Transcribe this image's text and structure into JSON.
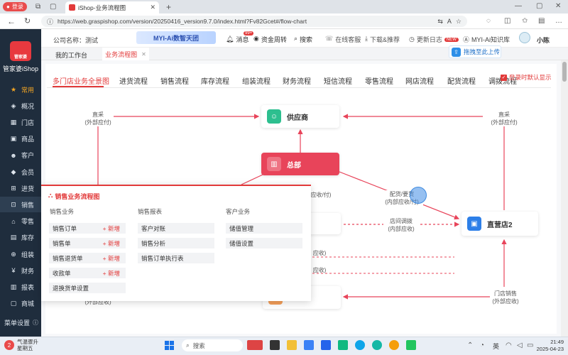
{
  "browser": {
    "profile_label": "登录",
    "tab_title": "iShop-业务流程图",
    "url": "https://web.graspishop.com/version/20250416_version9.7.0/index.html?Fv82Gcet#/flow-chart"
  },
  "header": {
    "company_label": "公司名称：测试",
    "banner": "MYI-Ai数智天团",
    "message_label": "消息",
    "message_badge": "99+",
    "funds_label": "资金周转",
    "search_label": "搜索",
    "service_label": "在线客服",
    "download_label": "下载&推荐",
    "update_label": "更新日志",
    "new_badge": "NEW",
    "ai_label": "MYI-Ai知识库",
    "user_name": "小陈",
    "drag_hint": "拖拽至此上传"
  },
  "page_tabs": {
    "workspace": "我的工作台",
    "flow": "业务流程图"
  },
  "sidebar": {
    "logo_text": "管家婆",
    "brand": "管家婆iShop",
    "items": [
      {
        "label": "常用",
        "icon": "star-icon",
        "color": "#f5a623"
      },
      {
        "label": "概况",
        "icon": "layers-icon"
      },
      {
        "label": "门店",
        "icon": "store-icon"
      },
      {
        "label": "商品",
        "icon": "box-icon"
      },
      {
        "label": "客户",
        "icon": "user-icon"
      },
      {
        "label": "会员",
        "icon": "diamond-icon"
      },
      {
        "label": "进货",
        "icon": "cart-icon"
      },
      {
        "label": "销售",
        "icon": "bag-icon"
      },
      {
        "label": "零售",
        "icon": "shop-icon"
      },
      {
        "label": "库存",
        "icon": "warehouse-icon"
      },
      {
        "label": "组装",
        "icon": "assemble-icon"
      },
      {
        "label": "财务",
        "icon": "finance-icon"
      },
      {
        "label": "报表",
        "icon": "report-icon"
      },
      {
        "label": "商城",
        "icon": "mall-icon"
      }
    ],
    "settings_label": "菜单设置"
  },
  "flow_tabs": [
    "多门店业务全景图",
    "进货流程",
    "销售流程",
    "库存流程",
    "组装流程",
    "财务流程",
    "短信流程",
    "零售流程",
    "网店流程",
    "配货流程",
    "调拨流程"
  ],
  "default_display": "登录时默认显示",
  "flow": {
    "supplier": "供应商",
    "hq": "总部",
    "store2": "直营店2",
    "direct_left": "直采",
    "direct_left_sub": "(外部应付)",
    "direct_right": "直采",
    "direct_right_sub": "(外部应付)",
    "distribute": "配货/要货",
    "distribute_sub": "(内部应收/付)",
    "transfer": "店间调拨",
    "transfer_sub": "(内部应收)",
    "store_sale": "门店销售",
    "store_sale_sub": "(外部应收)",
    "partial_1": "应收/付)",
    "partial_2": "应收)",
    "partial_3": "应收)",
    "partial_4": "(外部应收)"
  },
  "popup": {
    "title": "销售业务流程图",
    "col1": "销售业务",
    "col2": "销售报表",
    "col3": "客户业务",
    "add": "+ 新增",
    "sales_items": [
      "销售订单",
      "销售单",
      "销售退货单",
      "收款单",
      "退换货单设置"
    ],
    "report_items": [
      "客户对账",
      "销售分析",
      "销售订单执行表"
    ],
    "customer_items": [
      "储值管理",
      "储值设置"
    ]
  },
  "taskbar": {
    "weather": "气温骤升",
    "weekday": "星期五",
    "weather_badge": "2",
    "search": "搜索",
    "lang": "英",
    "time": "21:49",
    "date": "2025-04-23"
  }
}
